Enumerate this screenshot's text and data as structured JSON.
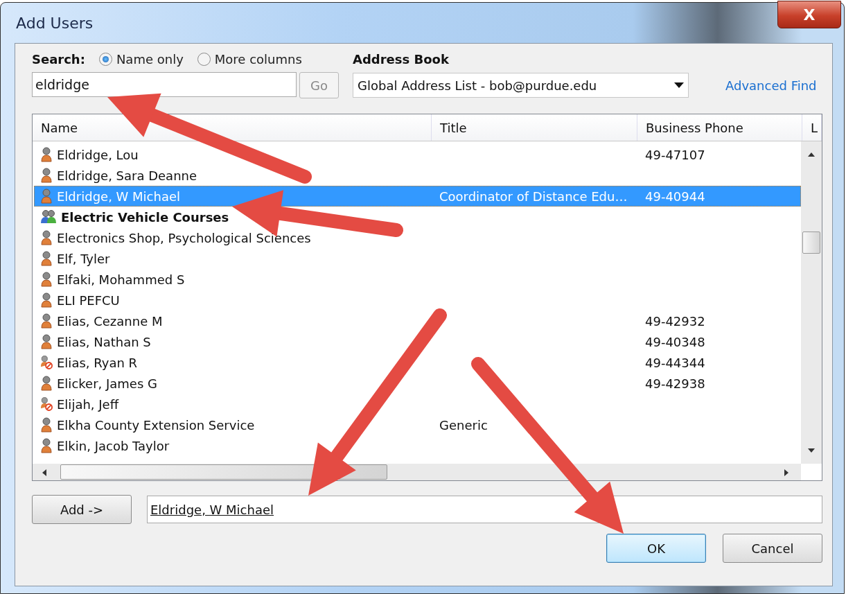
{
  "window": {
    "title": "Add Users",
    "close_label": "X"
  },
  "search": {
    "label": "Search:",
    "options": [
      {
        "label": "Name only",
        "selected": true
      },
      {
        "label": "More columns",
        "selected": false
      }
    ],
    "value": "eldridge",
    "go_label": "Go"
  },
  "address_book": {
    "label": "Address Book",
    "value": "Global Address List - bob@purdue.edu",
    "advanced_find": "Advanced Find"
  },
  "table": {
    "columns": [
      "Name",
      "Title",
      "Business Phone",
      "L"
    ],
    "rows": [
      {
        "kind": "user",
        "name": "Eldridge, Lou",
        "title": "",
        "phone": "49-47107",
        "selected": false
      },
      {
        "kind": "user",
        "name": "Eldridge, Sara Deanne",
        "title": "",
        "phone": "",
        "selected": false
      },
      {
        "kind": "user",
        "name": "Eldridge, W Michael",
        "title": "Coordinator of Distance Edu…",
        "phone": "49-40944",
        "selected": true
      },
      {
        "kind": "group",
        "name": "Electric Vehicle Courses",
        "title": "",
        "phone": "",
        "selected": false
      },
      {
        "kind": "user",
        "name": "Electronics Shop, Psychological Sciences",
        "title": "",
        "phone": "",
        "selected": false
      },
      {
        "kind": "user",
        "name": "Elf, Tyler",
        "title": "",
        "phone": "",
        "selected": false
      },
      {
        "kind": "user",
        "name": "Elfaki, Mohammed S",
        "title": "",
        "phone": "",
        "selected": false
      },
      {
        "kind": "user",
        "name": "ELI PEFCU",
        "title": "",
        "phone": "",
        "selected": false
      },
      {
        "kind": "user",
        "name": "Elias, Cezanne M",
        "title": "",
        "phone": "49-42932",
        "selected": false
      },
      {
        "kind": "user",
        "name": "Elias, Nathan S",
        "title": "",
        "phone": "49-40348",
        "selected": false
      },
      {
        "kind": "blocked-user",
        "name": "Elias, Ryan R",
        "title": "",
        "phone": "49-44344",
        "selected": false
      },
      {
        "kind": "user",
        "name": "Elicker, James G",
        "title": "",
        "phone": "49-42938",
        "selected": false
      },
      {
        "kind": "blocked-user",
        "name": "Elijah, Jeff",
        "title": "",
        "phone": "",
        "selected": false
      },
      {
        "kind": "user",
        "name": "Elkha County Extension Service",
        "title": "Generic",
        "phone": "",
        "selected": false
      },
      {
        "kind": "user",
        "name": "Elkin, Jacob Taylor",
        "title": "",
        "phone": "",
        "selected": false
      }
    ]
  },
  "add": {
    "button": "Add ->",
    "value": "Eldridge, W Michael"
  },
  "buttons": [
    {
      "label": "OK",
      "kind": "default"
    },
    {
      "label": "Cancel",
      "kind": "normal"
    }
  ]
}
